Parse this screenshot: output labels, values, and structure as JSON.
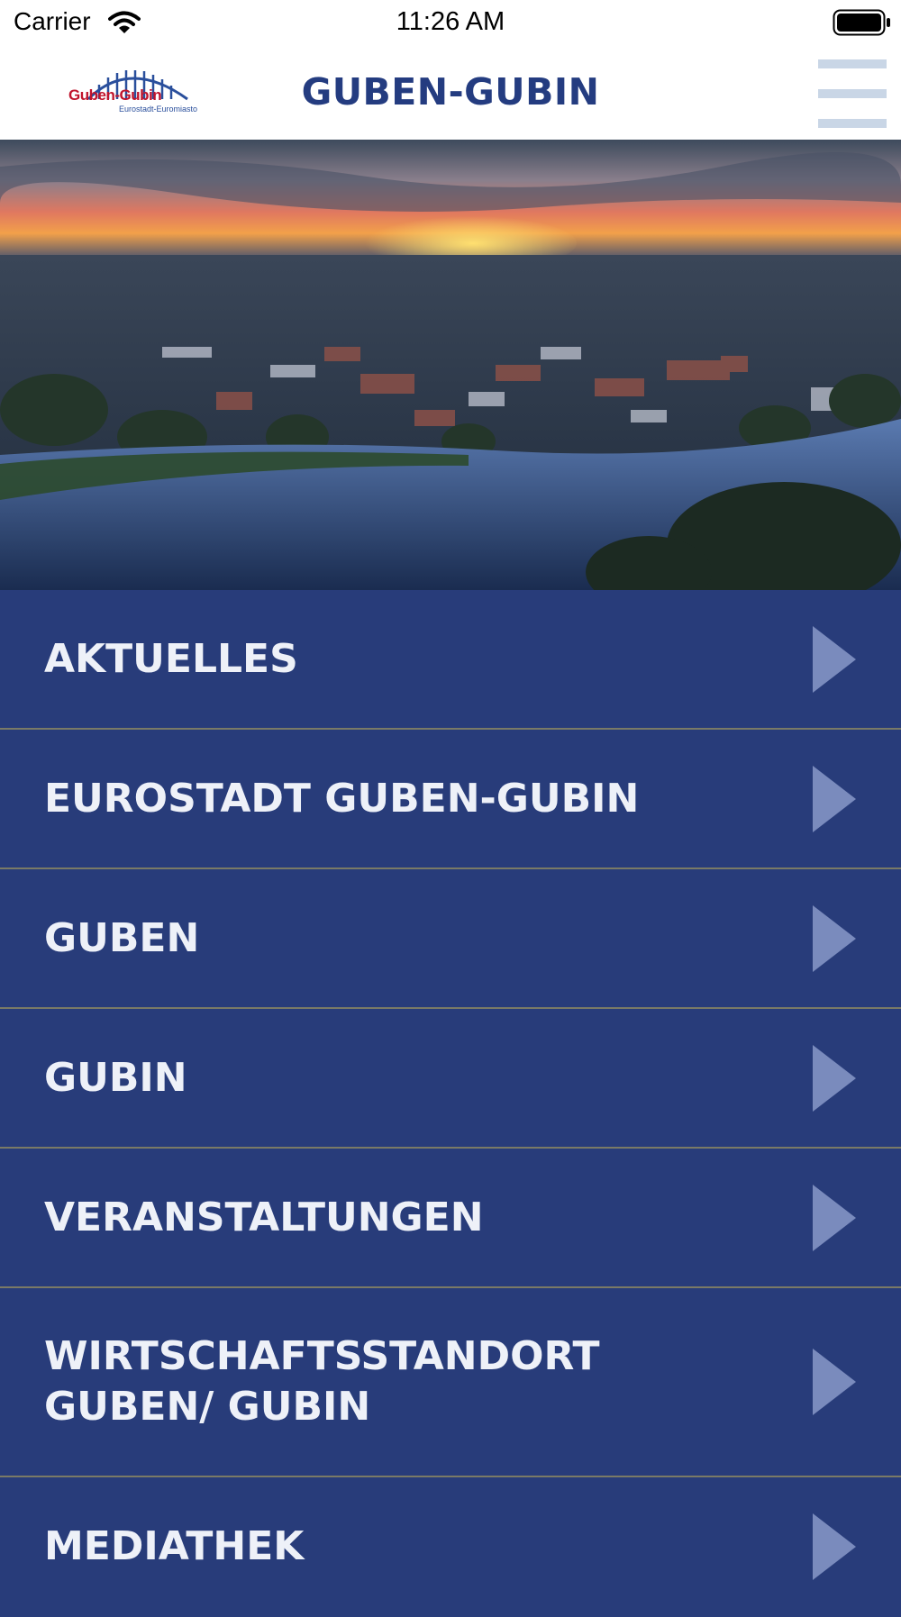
{
  "status_bar": {
    "carrier": "Carrier",
    "time": "11:26 AM"
  },
  "nav": {
    "title": "GUBEN-GUBIN",
    "logo_text": "Guben-Gubin",
    "logo_subtext": "Eurostadt-Euromiasto",
    "menu_icon": "hamburger-icon"
  },
  "hero": {
    "icon": "aerial-city-photo"
  },
  "colors": {
    "accent": "#243c80",
    "menu_bg": "#283c7a",
    "logo_red": "#c0142c",
    "divider": "#7a7a66"
  },
  "menu": {
    "items": [
      {
        "label": "AKTUELLES"
      },
      {
        "label": "EUROSTADT GUBEN-GUBIN"
      },
      {
        "label": "GUBEN"
      },
      {
        "label": "GUBIN"
      },
      {
        "label": "VERANSTALTUNGEN"
      },
      {
        "label": "WIRTSCHAFTSSTANDORT GUBEN/ GUBIN"
      },
      {
        "label": "MEDIATHEK"
      }
    ]
  }
}
